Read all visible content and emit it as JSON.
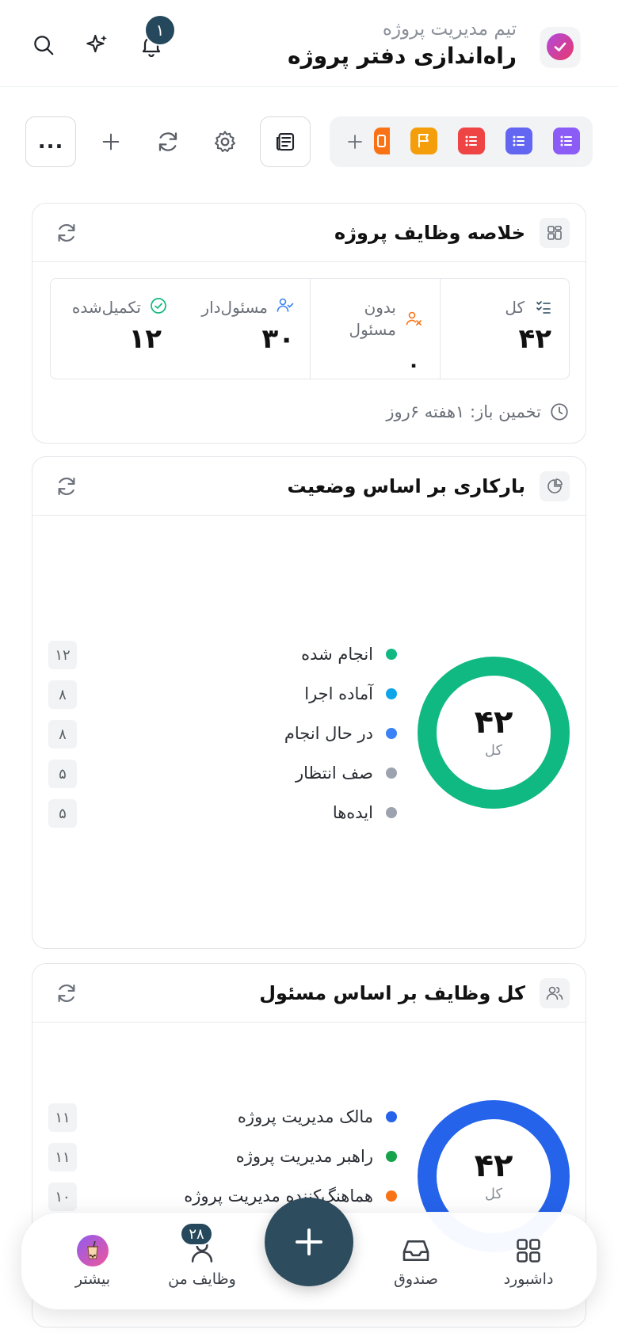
{
  "header": {
    "subtitle": "تیم مدیریت پروژه",
    "title": "راه‌اندازی دفتر پروژه",
    "notification_count": "۱"
  },
  "toolbar": {
    "strip_icons": [
      "list-icon",
      "list-icon",
      "list-icon",
      "flag-icon",
      "orange-icon"
    ],
    "strip_colors": [
      "#8b5cf6",
      "#6366f1",
      "#ef4444",
      "#f59e0b",
      "#f97316"
    ],
    "more_label": "..."
  },
  "summary": {
    "title": "خلاصه وظایف پروژه",
    "total_label": "کل",
    "total_value": "۴۲",
    "unassigned_label": "بدون مسئول",
    "unassigned_value": "۰",
    "assigned_label": "مسئول‌دار",
    "assigned_value": "۳۰",
    "completed_label": "تکمیل‌شده",
    "completed_value": "۱۲",
    "estimate": "تخمین باز: ۱هفته ۶روز"
  },
  "status_workload": {
    "title": "بارکاری بر اساس وضعیت",
    "total": "۴۲",
    "total_caption": "کل",
    "ring_color": "#10b981",
    "items": [
      {
        "label": "انجام شده",
        "count": "۱۲",
        "color": "#10b981"
      },
      {
        "label": "آماده اجرا",
        "count": "۸",
        "color": "#0ea5e9"
      },
      {
        "label": "در حال انجام",
        "count": "۸",
        "color": "#3b82f6"
      },
      {
        "label": "صف انتظار",
        "count": "۵",
        "color": "#9ca3af"
      },
      {
        "label": "ایده‌ها",
        "count": "۵",
        "color": "#9ca3af"
      }
    ]
  },
  "assignee_tasks": {
    "title": "کل وظایف بر اساس مسئول",
    "total": "۴۲",
    "total_caption": "کل",
    "ring_color": "#2563eb",
    "items": [
      {
        "label": "مالک مدیریت پروژه",
        "count": "۱۱",
        "color": "#2563eb"
      },
      {
        "label": "راهبر مدیریت پروژه",
        "count": "۱۱",
        "color": "#16a34a"
      },
      {
        "label": "هماهنگ‌کننده مدیریت پروژه",
        "count": "۱۰",
        "color": "#f97316"
      }
    ]
  },
  "bottom_nav": {
    "dashboard": "داشبورد",
    "inbox": "صندوق",
    "my_tasks": "وظایف من",
    "my_tasks_badge": "۲۸",
    "more": "بیشتر"
  }
}
